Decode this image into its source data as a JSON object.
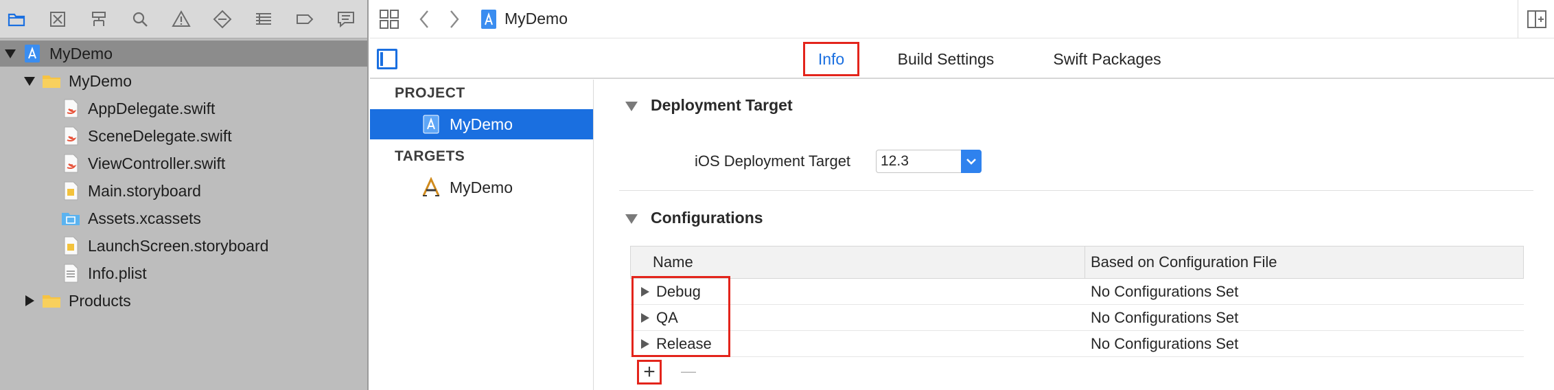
{
  "navigator": {
    "toolbar_icons": [
      "folder-icon",
      "source-control-icon",
      "symbol-navigator-icon",
      "find-icon",
      "issue-warning-icon",
      "test-diamond-icon",
      "debug-list-icon",
      "breakpoint-tag-icon",
      "report-bubble-icon"
    ],
    "tree": [
      {
        "label": "MyDemo",
        "icon": "xcode-project-icon",
        "level": 0,
        "expanded": true
      },
      {
        "label": "MyDemo",
        "icon": "yellow-folder-icon",
        "level": 1,
        "expanded": true
      },
      {
        "label": "AppDelegate.swift",
        "icon": "swift-file-icon",
        "level": 2
      },
      {
        "label": "SceneDelegate.swift",
        "icon": "swift-file-icon",
        "level": 2
      },
      {
        "label": "ViewController.swift",
        "icon": "swift-file-icon",
        "level": 2
      },
      {
        "label": "Main.storyboard",
        "icon": "storyboard-file-icon",
        "level": 2
      },
      {
        "label": "Assets.xcassets",
        "icon": "asset-catalog-icon",
        "level": 2
      },
      {
        "label": "LaunchScreen.storyboard",
        "icon": "storyboard-file-icon",
        "level": 2
      },
      {
        "label": "Info.plist",
        "icon": "plist-file-icon",
        "level": 2
      },
      {
        "label": "Products",
        "icon": "yellow-folder-icon",
        "level": 1,
        "expanded": false
      }
    ]
  },
  "editor": {
    "breadcrumb_title": "MyDemo",
    "tabs": [
      {
        "label": "Info",
        "selected": true
      },
      {
        "label": "Build Settings",
        "selected": false
      },
      {
        "label": "Swift Packages",
        "selected": false
      }
    ]
  },
  "target_list": {
    "project_header": "PROJECT",
    "project_item": "MyDemo",
    "targets_header": "TARGETS",
    "target_item": "MyDemo"
  },
  "settings": {
    "deployment_group_title": "Deployment Target",
    "deployment_label": "iOS Deployment Target",
    "deployment_value": "12.3",
    "configurations_group_title": "Configurations",
    "table_headers": {
      "name": "Name",
      "based_on": "Based on Configuration File"
    },
    "configurations": [
      {
        "name": "Debug",
        "based_on": "No Configurations Set"
      },
      {
        "name": "QA",
        "based_on": "No Configurations Set"
      },
      {
        "name": "Release",
        "based_on": "No Configurations Set"
      }
    ],
    "add_symbol": "+",
    "remove_symbol": "—"
  },
  "colors": {
    "accent": "#1a6fe0",
    "selection": "#1a6fe0",
    "highlight_box": "#e3241b",
    "navigator_bg": "#bdbdbd"
  }
}
